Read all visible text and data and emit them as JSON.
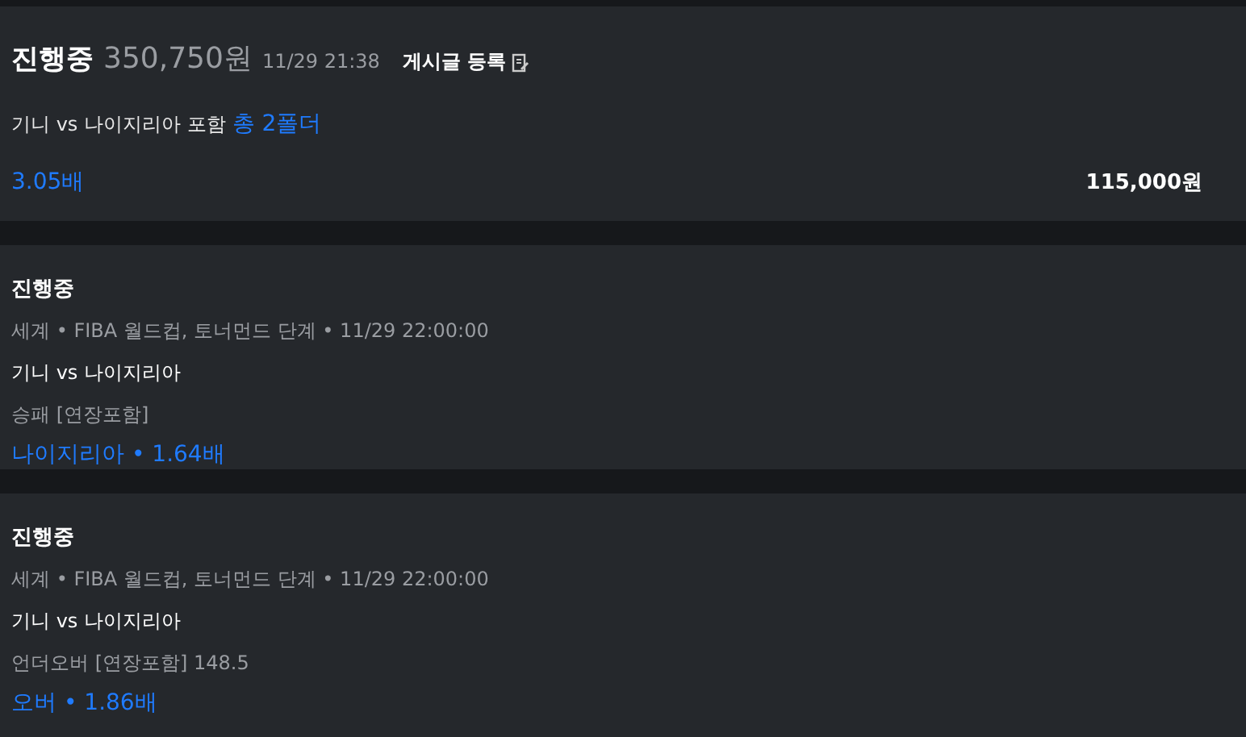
{
  "summary": {
    "status": "진행중",
    "amount": "350,750원",
    "time": "11/29 21:38",
    "post_button": "게시글 등록",
    "match_text": "기니 vs 나이지리아 포함",
    "folder_count": "총 2폴더",
    "odds": "3.05배",
    "stake": "115,000원"
  },
  "bets": [
    {
      "status": "진행중",
      "league_info": "세계  •  FIBA 월드컵, 토너먼드 단계  •  11/29 22:00:00",
      "match": "기니 vs 나이지리아",
      "market": "승패 [연장포함]",
      "pick": "나이지리아  •  1.64배"
    },
    {
      "status": "진행중",
      "league_info": "세계  •  FIBA 월드컵, 토너먼드 단계  •  11/29 22:00:00",
      "match": "기니 vs 나이지리아",
      "market": "언더오버 [연장포함] 148.5",
      "pick": "오버  •  1.86배"
    }
  ]
}
